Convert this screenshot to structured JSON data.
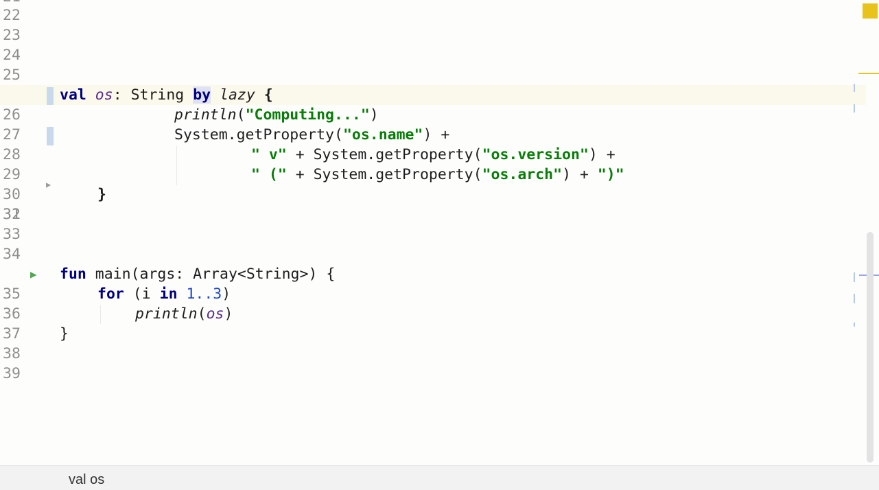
{
  "editor": {
    "lines": [
      {
        "n": "22"
      },
      {
        "n": "23"
      },
      {
        "n": "24"
      },
      {
        "n": "25"
      },
      {
        "n": "26"
      },
      {
        "n": "27"
      },
      {
        "n": "28"
      },
      {
        "n": "29"
      },
      {
        "n": "30"
      },
      {
        "n": "31"
      },
      {
        "n": "32"
      },
      {
        "n": "33"
      },
      {
        "n": "34"
      },
      {
        "n": "35"
      },
      {
        "n": "36"
      },
      {
        "n": "37"
      },
      {
        "n": "38"
      },
      {
        "n": "39"
      }
    ],
    "code": {
      "l26": {
        "kw_val": "val",
        "name": "os",
        "colon": ": String ",
        "kw_by": "by",
        "lazy": "lazy",
        "brace": " {"
      },
      "l27": {
        "fn": "println",
        "open": "(",
        "str": "\"Computing...\"",
        "close": ")"
      },
      "l28": {
        "a": "System.getProperty(",
        "str": "\"os.name\"",
        "b": ") +"
      },
      "l29": {
        "s1": "\" v\"",
        "a": " + System.getProperty(",
        "s2": "\"os.version\"",
        "b": ") +"
      },
      "l30": {
        "s1": "\" (\"",
        "a": " + System.getProperty(",
        "s2": "\"os.arch\"",
        "b": ") + ",
        "s3": "\")\""
      },
      "l31": {
        "brace": "}"
      },
      "l35": {
        "kw_fun": "fun",
        "rest": " main(args: Array<String>) {"
      },
      "l36": {
        "kw_for": "for",
        "a": " (i ",
        "kw_in": "in",
        "sp": " ",
        "num": "1..3",
        "b": ")"
      },
      "l37": {
        "fn": "println",
        "open": "(",
        "arg": "os",
        "close": ")"
      },
      "l38": {
        "brace": "}"
      }
    }
  },
  "status_bar": {
    "breadcrumb": "val os"
  },
  "colors": {
    "keyword": "#000080",
    "string": "#087d08",
    "number": "#1a49c9",
    "property": "#5a2d86",
    "inspection": "#e8c31c"
  },
  "icons": {
    "run": "run-gutter-icon",
    "fold": "fold-arrow-icon"
  }
}
